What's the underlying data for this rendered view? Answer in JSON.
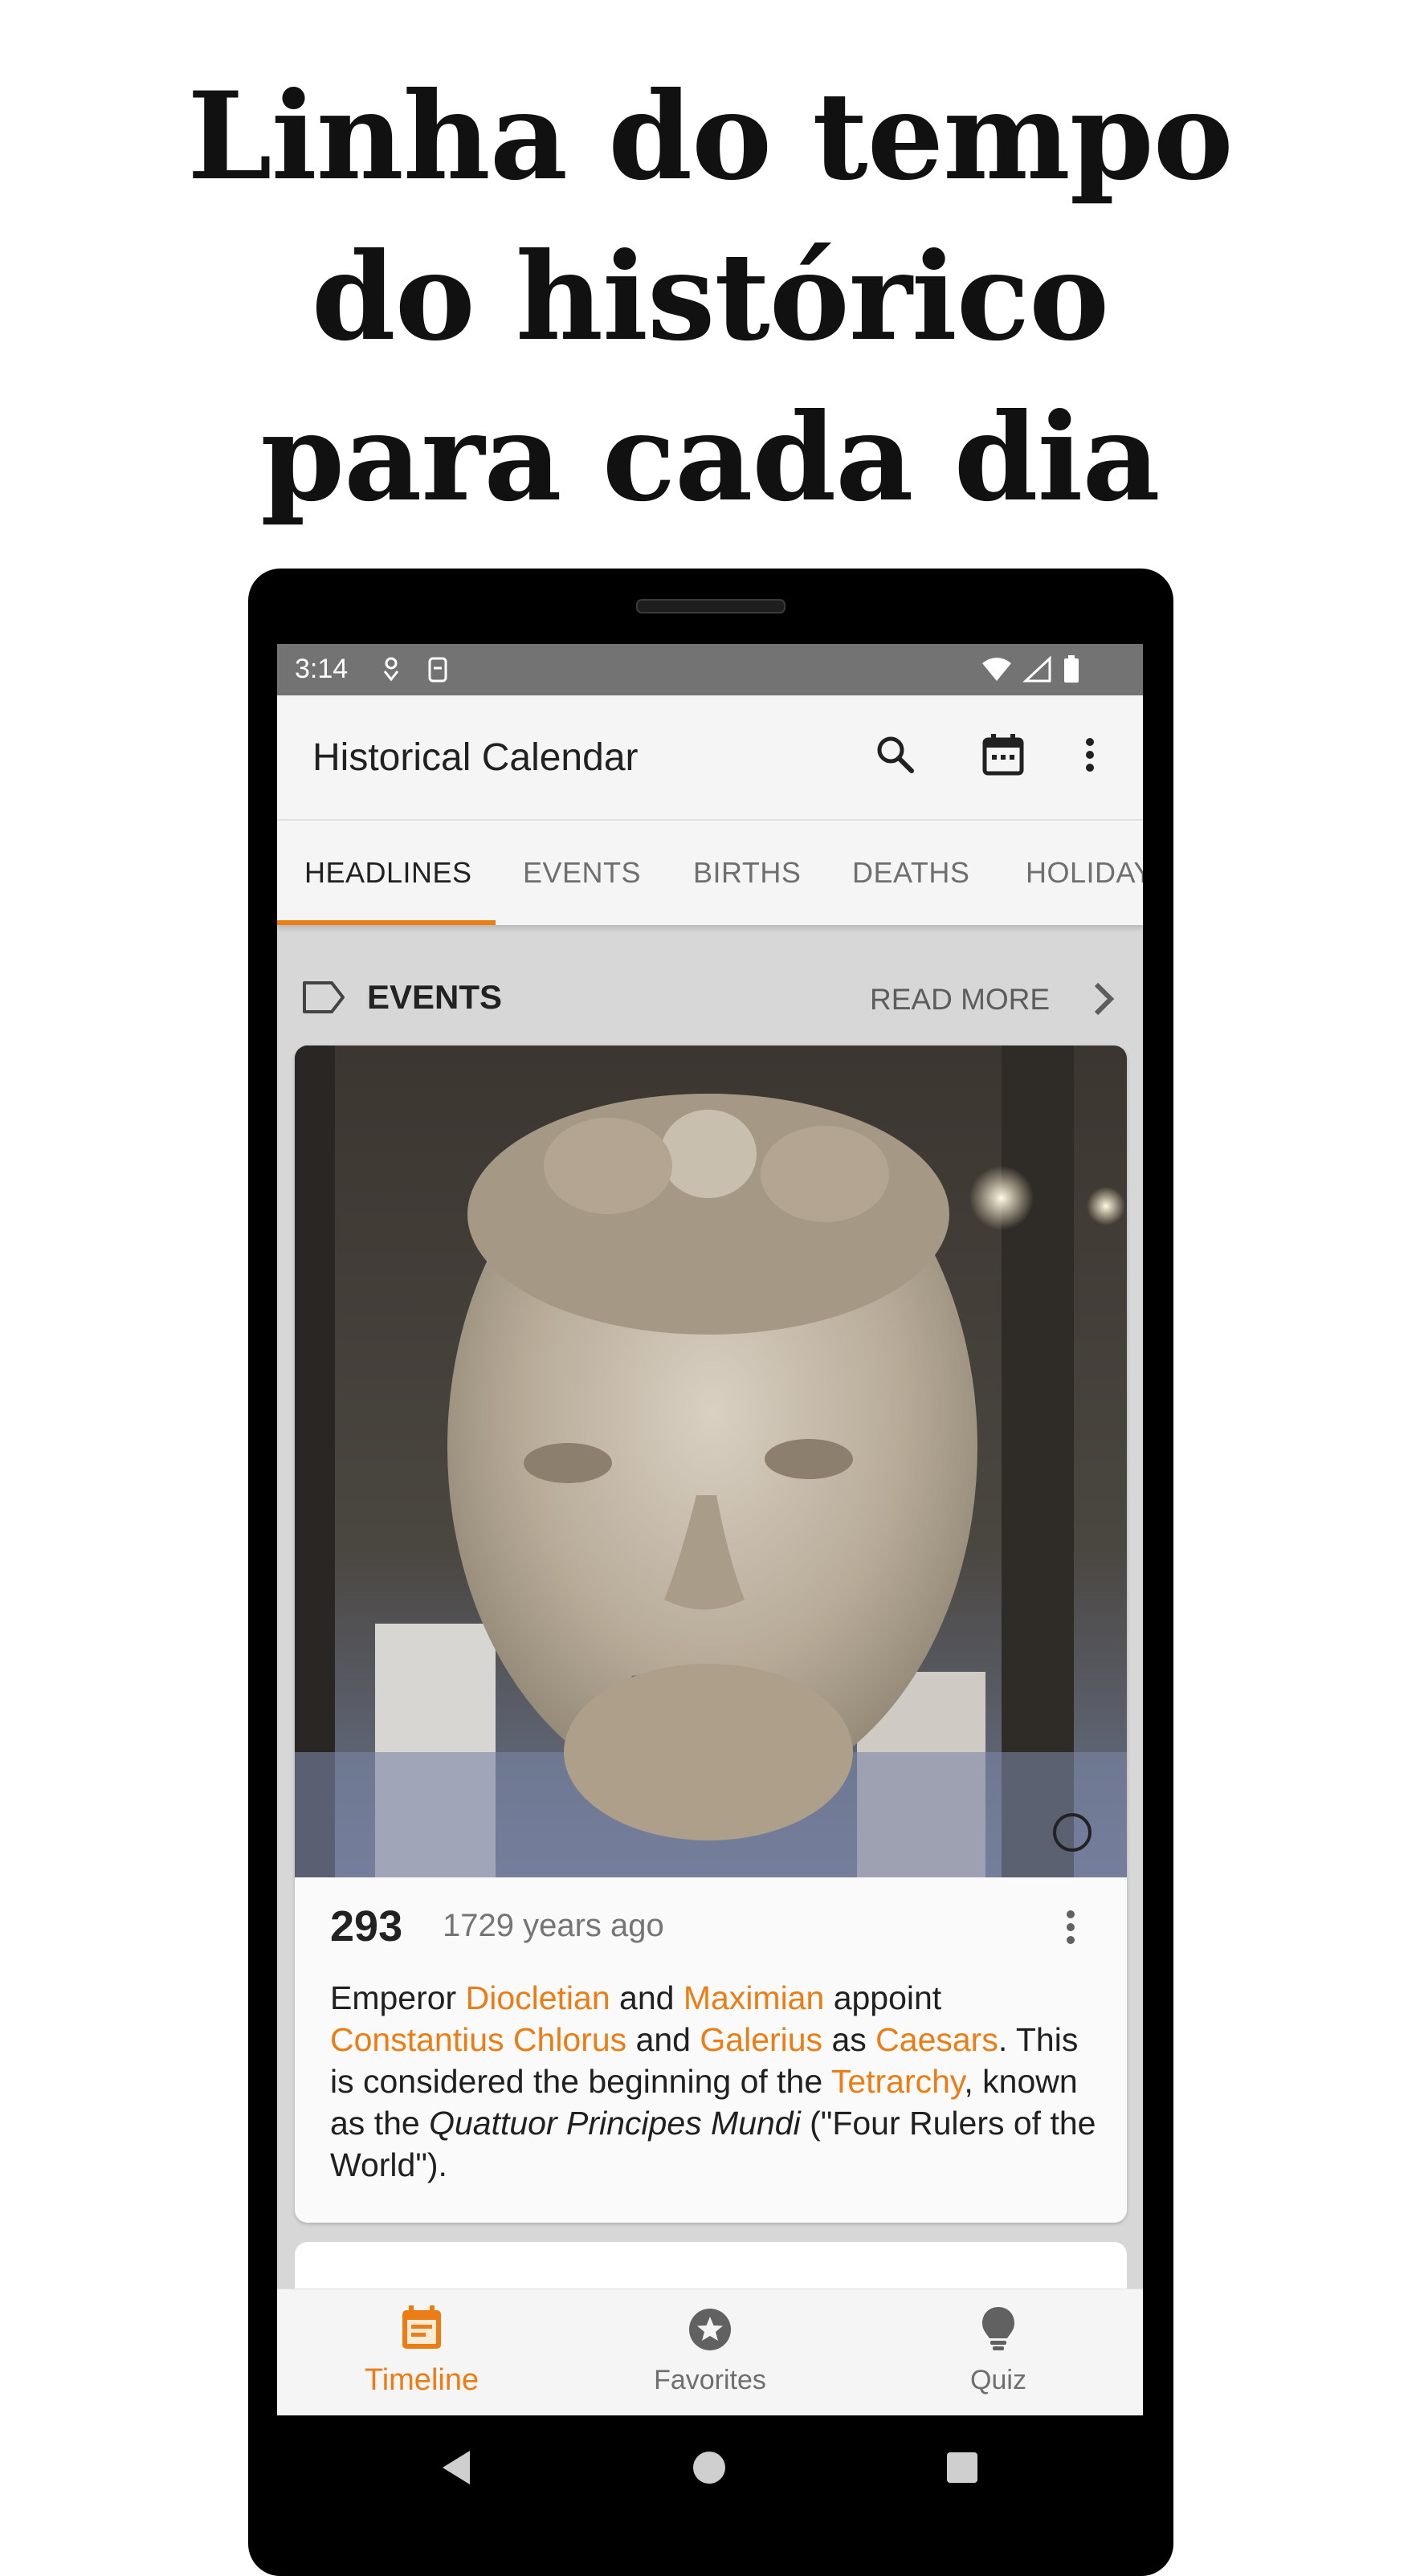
{
  "promo": {
    "line1": "Linha do tempo",
    "line2": "do histórico",
    "line3": "para cada dia"
  },
  "status_bar": {
    "time": "3:14"
  },
  "app_bar": {
    "title": "Historical Calendar"
  },
  "tabs": [
    {
      "label": "HEADLINES",
      "active": true
    },
    {
      "label": "EVENTS",
      "active": false
    },
    {
      "label": "BIRTHS",
      "active": false
    },
    {
      "label": "DEATHS",
      "active": false
    },
    {
      "label": "HOLIDAYS",
      "active": false
    }
  ],
  "section": {
    "label": "EVENTS",
    "read_more": "READ MORE"
  },
  "event_card": {
    "year": "293",
    "ago": "1729 years ago",
    "text": {
      "p1": "Emperor ",
      "link1": "Diocletian",
      "p2": " and ",
      "link2": "Maximian",
      "p3": " appoint ",
      "link3": "Constantius Chlorus",
      "p4": " and ",
      "link4": "Galerius",
      "p5": " as ",
      "link5": "Caesars",
      "p6": ". This is considered the beginning of the ",
      "link6": "Tetrarchy",
      "p7": ", known as the ",
      "italic": "Quattuor Principes Mundi",
      "p8": " (\"Four Rulers of the World\")."
    }
  },
  "bottom_nav": [
    {
      "label": "Timeline",
      "icon": "calendar-icon",
      "active": true
    },
    {
      "label": "Favorites",
      "icon": "star-icon",
      "active": false
    },
    {
      "label": "Quiz",
      "icon": "lightbulb-icon",
      "active": false
    }
  ],
  "colors": {
    "accent": "#ec7d14",
    "status_bar": "#737373",
    "app_bar": "#f5f5f5"
  }
}
